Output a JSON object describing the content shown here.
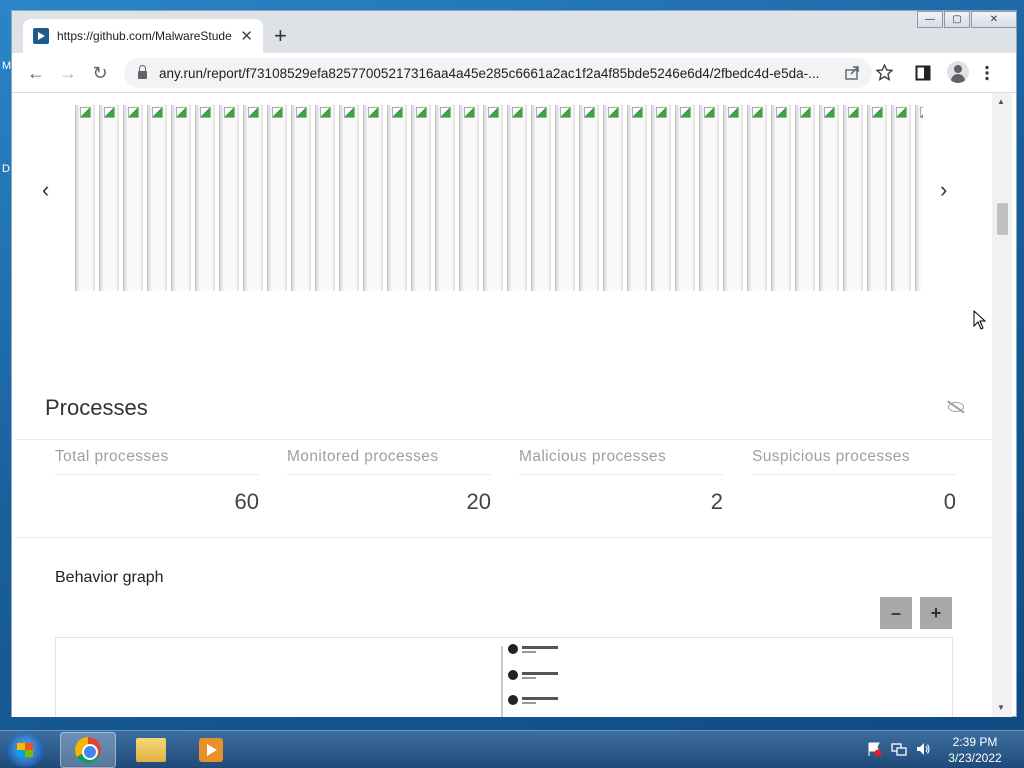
{
  "desktop": {
    "left_letters": [
      "M",
      "D"
    ]
  },
  "tab": {
    "title": "https://github.com/MalwareStudent",
    "close_glyph": "✕"
  },
  "newtab_glyph": "+",
  "window_controls": {
    "minimize": "—",
    "maximize": "▢",
    "close": "✕"
  },
  "toolbar": {
    "back": "←",
    "forward": "→",
    "reload": "↻",
    "url": "any.run/report/f73108529efa82577005217316aa4a45e285c6661a2ac1f2a4f85bde5246e6d4/2fbedc4d-e5da-..."
  },
  "carousel": {
    "prev": "‹",
    "next": "›",
    "thumb_count": 36
  },
  "processes": {
    "title": "Processes",
    "stats": [
      {
        "label": "Total processes",
        "value": "60"
      },
      {
        "label": "Monitored processes",
        "value": "20"
      },
      {
        "label": "Malicious processes",
        "value": "2"
      },
      {
        "label": "Suspicious processes",
        "value": "0"
      }
    ]
  },
  "behavior": {
    "title": "Behavior graph",
    "zoom_out": "–",
    "zoom_in": "+"
  },
  "taskbar": {
    "time": "2:39 PM",
    "date": "3/23/2022"
  }
}
